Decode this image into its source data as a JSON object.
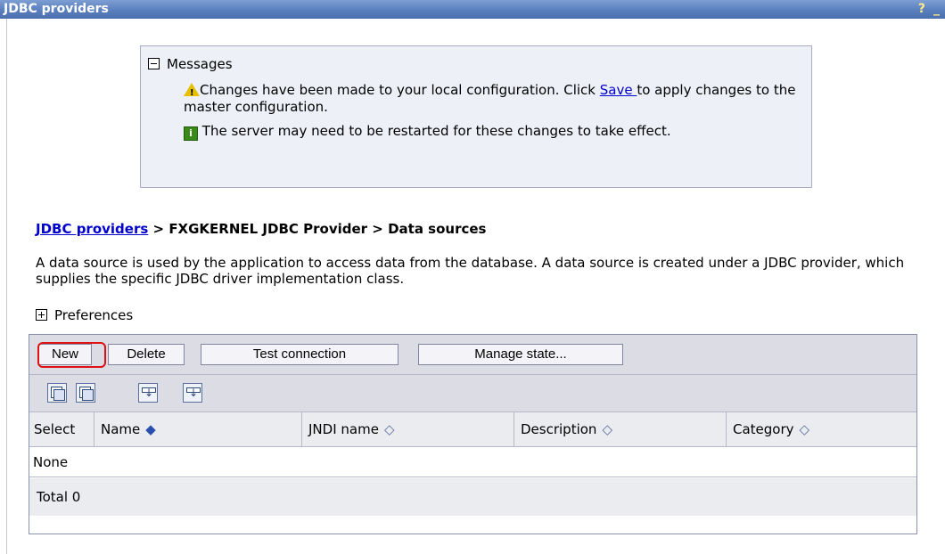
{
  "window": {
    "title": "JDBC providers",
    "help_label": "?",
    "minimize_label": "_"
  },
  "messages": {
    "header": "Messages",
    "warning_text_before": "Changes have been made to your local configuration. Click ",
    "warning_link": "Save ",
    "warning_text_after": "to apply changes to the master configuration.",
    "info_icon_label": "i",
    "info_text": "The server may need to be restarted for these changes to take effect."
  },
  "breadcrumb": {
    "link": "JDBC providers",
    "sep1": " > ",
    "item2": "FXGKERNEL JDBC Provider",
    "sep2": " > ",
    "item3": "Data sources"
  },
  "description": "A data source is used by the application to access data from the database. A data source is created under a JDBC provider, which supplies the specific JDBC driver implementation class.",
  "preferences_label": "Preferences",
  "toolbar": {
    "new_label": "New",
    "delete_label": "Delete",
    "test_label": "Test connection",
    "manage_label": "Manage state..."
  },
  "icon_bar": [
    "select-all-icon",
    "deselect-all-icon",
    "show-filter-icon",
    "clear-filter-icon"
  ],
  "table": {
    "headers": [
      "Select",
      "Name",
      "JNDI name",
      "Description",
      "Category"
    ],
    "sort_glyph": "◇",
    "active_sort_glyph": "◆",
    "empty_text": "None",
    "total_text": "Total 0"
  },
  "colors": {
    "title_bar": "#5a7fbd",
    "message_bg": "#eef0f8",
    "highlight": "#dd1111",
    "link": "#0000cc"
  }
}
